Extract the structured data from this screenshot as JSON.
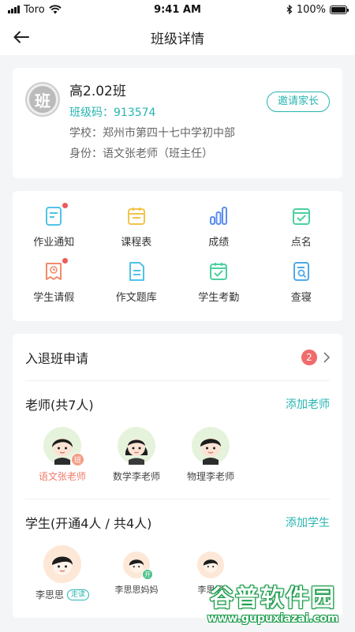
{
  "status_bar": {
    "carrier": "Toro",
    "time": "9:41 AM",
    "battery": "100%"
  },
  "nav": {
    "title": "班级详情"
  },
  "class": {
    "avatar_char": "班",
    "name": "高2.02班",
    "code_label": "班级码：",
    "code": "913574",
    "school": "学校：郑州市第四十七中学初中部",
    "identity": "身份：语文张老师（班主任）",
    "invite_label": "邀请家长"
  },
  "functions": [
    {
      "label": "作业通知",
      "icon": "homework-notice-icon",
      "color": "#4fc3e8",
      "dot": true
    },
    {
      "label": "课程表",
      "icon": "timetable-icon",
      "color": "#f2c34c",
      "dot": false
    },
    {
      "label": "成绩",
      "icon": "grades-bar-icon",
      "color": "#5b8def",
      "dot": false
    },
    {
      "label": "点名",
      "icon": "roll-call-icon",
      "color": "#4cd0a0",
      "dot": false
    },
    {
      "label": "学生请假",
      "icon": "student-leave-icon",
      "color": "#f28c6b",
      "dot": true
    },
    {
      "label": "作文题库",
      "icon": "essay-bank-icon",
      "color": "#4fc3e8",
      "dot": false
    },
    {
      "label": "学生考勤",
      "icon": "attendance-icon",
      "color": "#4cd0a0",
      "dot": false
    },
    {
      "label": "查寝",
      "icon": "dorm-check-icon",
      "color": "#4fa8e8",
      "dot": false
    }
  ],
  "apply": {
    "title": "入退班申请",
    "count": "2"
  },
  "teachers": {
    "title": "老师(共7人)",
    "add_label": "添加老师",
    "list": [
      {
        "name": "语文张老师",
        "tag": "班",
        "highlight": true
      },
      {
        "name": "数学李老师",
        "tag": "",
        "highlight": false
      },
      {
        "name": "物理李老师",
        "tag": "",
        "highlight": false
      }
    ]
  },
  "students": {
    "title": "学生(开通4人 / 共4人)",
    "add_label": "添加学生",
    "list": [
      {
        "name": "李思思",
        "pill": "走读"
      },
      {
        "name": "李思思妈妈",
        "tag": "开"
      },
      {
        "name": "李思思"
      }
    ]
  },
  "watermark": {
    "title": "谷普软件园",
    "url": "www.gupuxiazai.com"
  },
  "colors": {
    "accent": "#27b5b0",
    "badge": "#f06b6b",
    "background": "#f4f5f7"
  }
}
